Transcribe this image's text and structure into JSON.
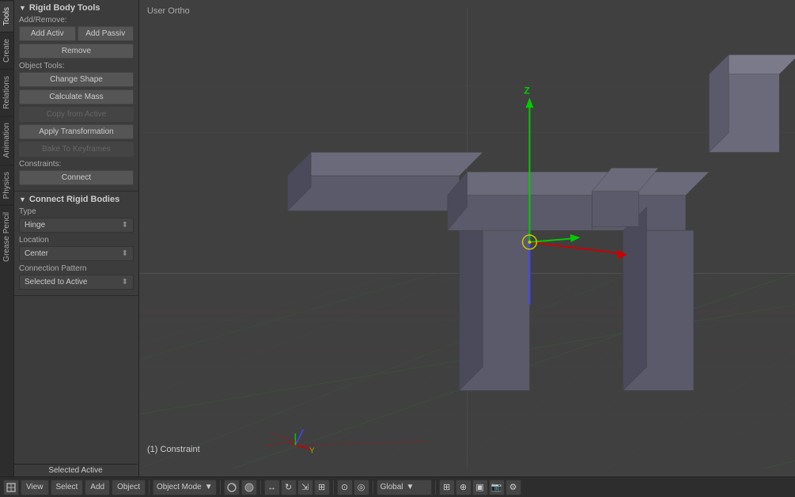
{
  "viewport": {
    "label": "User Ortho"
  },
  "left_panel": {
    "rigid_body_tools": {
      "header": "Rigid Body Tools",
      "add_remove_label": "Add/Remove:",
      "add_active_btn": "Add Activ",
      "add_passive_btn": "Add Passiv",
      "remove_btn": "Remove",
      "object_tools_label": "Object Tools:",
      "change_shape_btn": "Change Shape",
      "calculate_mass_btn": "Calculate Mass",
      "copy_from_active_btn": "Copy from Active",
      "apply_transformation_btn": "Apply Transformation",
      "bake_to_keyframes_btn": "Bake To Keyframes",
      "constraints_label": "Constraints:",
      "connect_btn": "Connect"
    },
    "connect_rigid_bodies": {
      "header": "Connect Rigid Bodies",
      "type_label": "Type",
      "type_value": "Hinge",
      "location_label": "Location",
      "location_value": "Center",
      "connection_pattern_label": "Connection Pattern",
      "connection_pattern_value": "Selected to Active"
    }
  },
  "vertical_tabs": [
    {
      "label": "Tools",
      "active": true
    },
    {
      "label": "Create",
      "active": false
    },
    {
      "label": "Relations",
      "active": false
    },
    {
      "label": "Animation",
      "active": false
    },
    {
      "label": "Physics",
      "active": false
    },
    {
      "label": "Grease Pencil",
      "active": false
    }
  ],
  "bottom_toolbar": {
    "view_btn": "View",
    "select_btn": "Select",
    "add_btn": "Add",
    "object_btn": "Object",
    "mode_btn": "Object Mode",
    "global_btn": "Global",
    "constraint_label": "(1) Constraint"
  },
  "selected_active_label": "Selected Active"
}
